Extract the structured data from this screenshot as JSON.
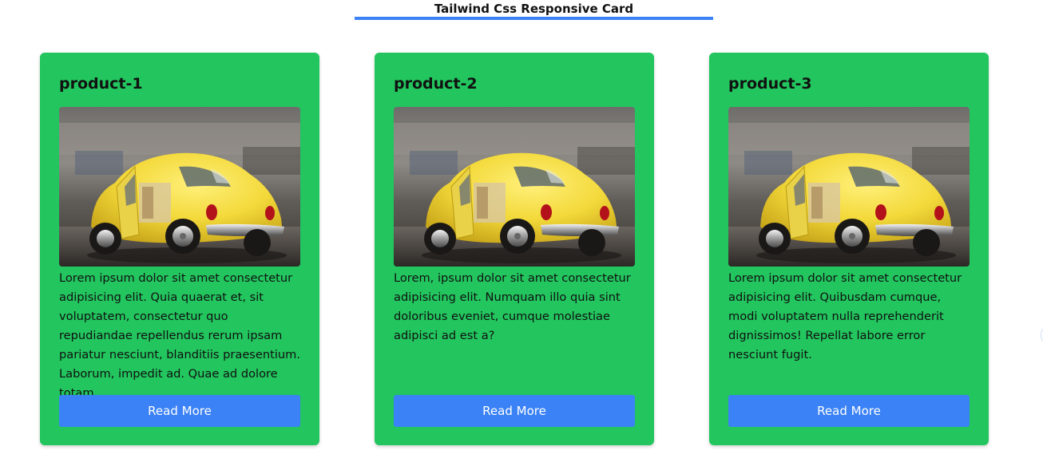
{
  "header": {
    "title": "Tailwind Css Responsive Card",
    "accent_color": "#3b82f6"
  },
  "card_color": "#22c55e",
  "button_color": "#3b82f6",
  "cards": [
    {
      "title": "product-1",
      "image_alt": "yellow-toy-car-image",
      "text": "Lorem ipsum dolor sit amet consectetur adipisicing elit. Quia quaerat et, sit voluptatem, consectetur quo repudiandae repellendus rerum ipsam pariatur nesciunt, blanditiis praesentium. Laborum, impedit ad. Quae ad dolore totam.",
      "button_label": "Read More"
    },
    {
      "title": "product-2",
      "image_alt": "yellow-toy-car-image",
      "text": "Lorem, ipsum dolor sit amet consectetur adipisicing elit. Numquam illo quia sint doloribus eveniet, cumque molestiae adipisci ad est a?",
      "button_label": "Read More"
    },
    {
      "title": "product-3",
      "image_alt": "yellow-toy-car-image",
      "text": "Lorem ipsum dolor sit amet consectetur adipisicing elit. Quibusdam cumque, modi voluptatem nulla reprehenderit dignissimos! Repellat labore error nesciunt fugit.",
      "button_label": "Read More"
    }
  ]
}
